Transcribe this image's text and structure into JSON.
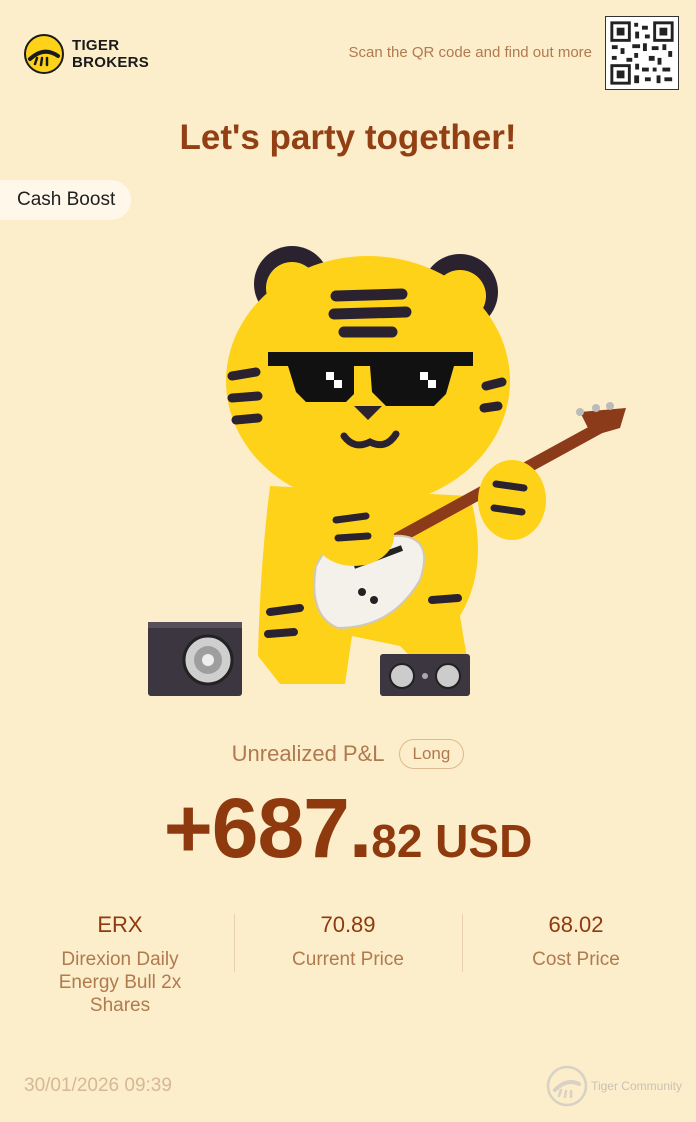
{
  "header": {
    "brand_line1": "TIGER",
    "brand_line2": "BROKERS",
    "qr_caption": "Scan the QR code and find out more"
  },
  "headline": "Let's party together!",
  "badge": "Cash Boost",
  "pl": {
    "label": "Unrealized P&L",
    "position_tag": "Long",
    "amount_main": "+687.",
    "amount_fraction": "82 USD"
  },
  "stats": [
    {
      "value": "ERX",
      "label": "Direxion Daily Energy Bull 2x Shares"
    },
    {
      "value": "70.89",
      "label": "Current Price"
    },
    {
      "value": "68.02",
      "label": "Cost Price"
    }
  ],
  "footer": {
    "timestamp": "30/01/2026 09:39",
    "community": "Tiger Community"
  },
  "icons": {
    "brand_logo": "tiger-brokers-logo",
    "qr": "qr-code-icon",
    "community_logo": "tiger-community-icon"
  },
  "colors": {
    "background": "#FCEECB",
    "headline": "#923F14",
    "amount": "#8E3A0E",
    "muted": "#B07A4F",
    "tiger_yellow": "#FFD21A"
  }
}
